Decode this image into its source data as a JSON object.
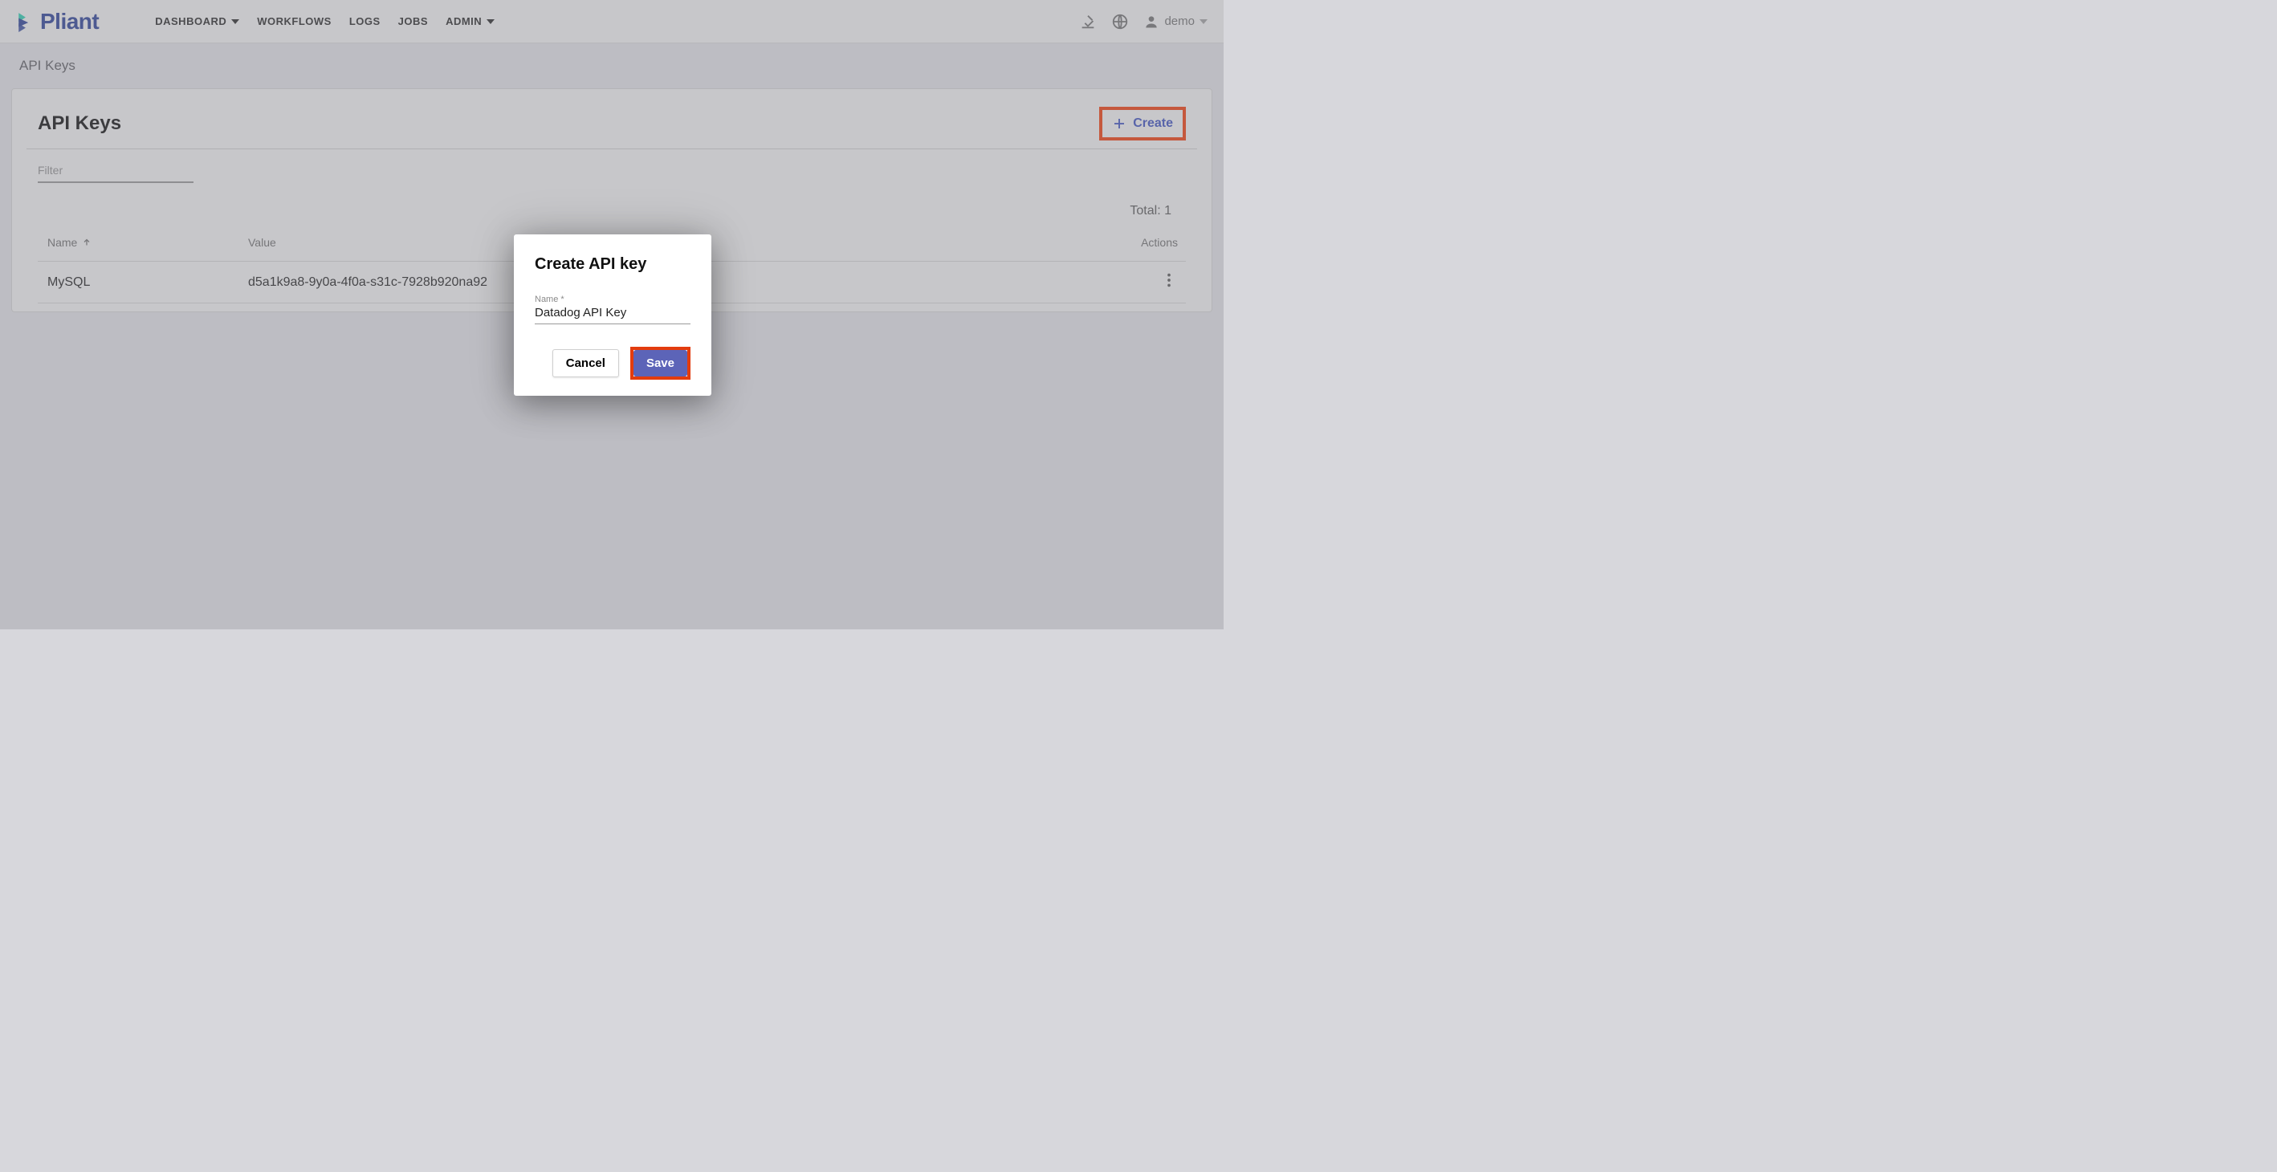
{
  "app": {
    "logo_text": "Pliant"
  },
  "nav": {
    "dashboard": "DASHBOARD",
    "workflows": "WORKFLOWS",
    "logs": "LOGS",
    "jobs": "JOBS",
    "admin": "ADMIN"
  },
  "user": {
    "name": "demo"
  },
  "breadcrumb": "API Keys",
  "page": {
    "title": "API Keys",
    "create_label": "Create",
    "filter_placeholder": "Filter",
    "total_label": "Total:",
    "total_count": "1"
  },
  "table": {
    "headers": {
      "name": "Name",
      "value": "Value",
      "actions": "Actions"
    },
    "rows": [
      {
        "name": "MySQL",
        "value": "d5a1k9a8-9y0a-4f0a-s31c-7928b920na92"
      }
    ]
  },
  "dialog": {
    "title": "Create API key",
    "name_label": "Name *",
    "name_value": "Datadog API Key",
    "cancel": "Cancel",
    "save": "Save"
  }
}
